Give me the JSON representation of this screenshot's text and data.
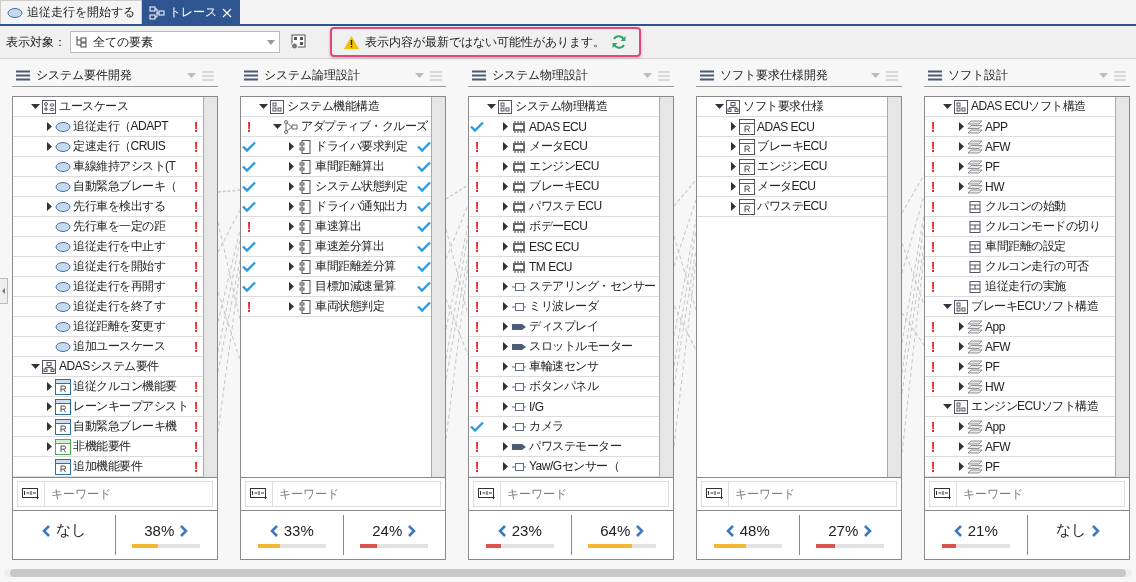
{
  "tabs": [
    {
      "label": "追従走行を開始する",
      "kind": "usecase",
      "selected": false,
      "closable": false
    },
    {
      "label": "トレース",
      "kind": "trace",
      "selected": true,
      "closable": true
    }
  ],
  "toolbar": {
    "label": "表示対象：",
    "target": "全ての要素",
    "warning": "表示内容が最新ではない可能性があります。"
  },
  "columns": [
    {
      "title": "システム要件開発",
      "search_placeholder": "キーワード",
      "tree": [
        {
          "label": "ユースケース",
          "kind": "usecase-diagram",
          "expanded": true,
          "children": [
            {
              "label": "追従走行（ADAPT",
              "kind": "usecase",
              "expanded": false,
              "mark_right": {
                "kind": "error",
                "text": "!"
              }
            },
            {
              "label": "定速走行（CRUIS",
              "kind": "usecase",
              "expanded": false,
              "mark_right": {
                "kind": "error",
                "text": "!"
              }
            },
            {
              "label": "車線維持アシスト(T",
              "kind": "usecase",
              "mark_right": {
                "kind": "error",
                "text": "!"
              }
            },
            {
              "label": "自動緊急ブレーキ（",
              "kind": "usecase",
              "mark_right": {
                "kind": "error",
                "text": "!"
              }
            },
            {
              "label": "先行車を検出する",
              "kind": "usecase",
              "expanded": false,
              "mark_right": {
                "kind": "error",
                "text": "!"
              }
            },
            {
              "label": "先行車を一定の距",
              "kind": "usecase",
              "mark_right": {
                "kind": "error",
                "text": "!"
              }
            },
            {
              "label": "追従走行を中止す",
              "kind": "usecase",
              "mark_right": {
                "kind": "error",
                "text": "!"
              }
            },
            {
              "label": "追従走行を開始す",
              "kind": "usecase",
              "mark_right": {
                "kind": "error",
                "text": "!"
              }
            },
            {
              "label": "追従走行を再開す",
              "kind": "usecase",
              "mark_right": {
                "kind": "error",
                "text": "!"
              }
            },
            {
              "label": "追従走行を終了す",
              "kind": "usecase",
              "mark_right": {
                "kind": "error",
                "text": "!"
              }
            },
            {
              "label": "追従距離を変更す",
              "kind": "usecase",
              "mark_right": {
                "kind": "error",
                "text": "!"
              }
            },
            {
              "label": "追加ユースケース",
              "kind": "usecase",
              "mark_right": {
                "kind": "error",
                "text": "!"
              }
            }
          ]
        },
        {
          "label": "ADASシステム要件",
          "kind": "package",
          "expanded": true,
          "children": [
            {
              "label": "追従クルコン機能要",
              "kind": "requirement",
              "expanded": false,
              "mark_right": {
                "kind": "error",
                "text": "!"
              }
            },
            {
              "label": "レーンキープアシスト",
              "kind": "requirement",
              "expanded": false,
              "mark_right": {
                "kind": "error",
                "text": "!"
              }
            },
            {
              "label": "自動緊急ブレーキ機",
              "kind": "requirement",
              "expanded": false,
              "mark_right": {
                "kind": "error",
                "text": "!"
              }
            },
            {
              "label": "非機能要件",
              "kind": "requirement-green",
              "expanded": false,
              "mark_right": {
                "kind": "error",
                "text": "!"
              }
            },
            {
              "label": "追加機能要件",
              "kind": "requirement",
              "mark_right": {
                "kind": "error",
                "text": "!"
              }
            }
          ]
        }
      ],
      "stats": [
        {
          "text": "なし"
        },
        {
          "text": "38%",
          "level": 0.38,
          "color": "#f5b731"
        }
      ]
    },
    {
      "title": "システム論理設計",
      "search_placeholder": "キーワード",
      "tree": [
        {
          "label": "システム機能構造",
          "kind": "structure",
          "expanded": true,
          "children": [
            {
              "label": "アダプティブ・クルーズ",
              "kind": "function",
              "expanded": true,
              "mark_left": {
                "kind": "error",
                "text": "!"
              },
              "children": [
                {
                  "label": "ドライバ要求判定",
                  "kind": "component",
                  "expanded": false,
                  "mark_left": {
                    "kind": "ok"
                  },
                  "mark_right": {
                    "kind": "ok"
                  }
                },
                {
                  "label": "車間距離算出",
                  "kind": "component",
                  "expanded": false,
                  "mark_left": {
                    "kind": "ok"
                  },
                  "mark_right": {
                    "kind": "ok"
                  }
                },
                {
                  "label": "システム状態判定",
                  "kind": "component",
                  "expanded": false,
                  "mark_left": {
                    "kind": "ok"
                  },
                  "mark_right": {
                    "kind": "ok"
                  }
                },
                {
                  "label": "ドライバ通知出力",
                  "kind": "component",
                  "expanded": false,
                  "mark_left": {
                    "kind": "ok"
                  },
                  "mark_right": {
                    "kind": "ok"
                  }
                },
                {
                  "label": "車速算出",
                  "kind": "component",
                  "expanded": false,
                  "mark_left": {
                    "kind": "error",
                    "text": "!"
                  },
                  "mark_right": {
                    "kind": "ok"
                  }
                },
                {
                  "label": "車速差分算出",
                  "kind": "component",
                  "expanded": false,
                  "mark_left": {
                    "kind": "ok"
                  },
                  "mark_right": {
                    "kind": "ok"
                  }
                },
                {
                  "label": "車間距離差分算",
                  "kind": "component",
                  "expanded": false,
                  "mark_left": {
                    "kind": "ok"
                  },
                  "mark_right": {
                    "kind": "ok"
                  }
                },
                {
                  "label": "目標加減速量算",
                  "kind": "component",
                  "expanded": false,
                  "mark_left": {
                    "kind": "ok"
                  },
                  "mark_right": {
                    "kind": "ok"
                  }
                },
                {
                  "label": "車両状態判定",
                  "kind": "component",
                  "expanded": false,
                  "mark_left": {
                    "kind": "error",
                    "text": "!"
                  },
                  "mark_right": {
                    "kind": "ok"
                  }
                }
              ]
            }
          ]
        }
      ],
      "stats": [
        {
          "text": "33%",
          "level": 0.33,
          "color": "#f5b731"
        },
        {
          "text": "24%",
          "level": 0.24,
          "color": "#d9534f"
        }
      ]
    },
    {
      "title": "システム物理設計",
      "search_placeholder": "キーワード",
      "tree": [
        {
          "label": "システム物理構造",
          "kind": "physical-structure",
          "expanded": true,
          "children": [
            {
              "label": "ADAS ECU",
              "kind": "ecu",
              "expanded": false,
              "mark_left": {
                "kind": "ok"
              }
            },
            {
              "label": "メータECU",
              "kind": "ecu",
              "expanded": false,
              "mark_left": {
                "kind": "error",
                "text": "!"
              }
            },
            {
              "label": "エンジンECU",
              "kind": "ecu",
              "expanded": false,
              "mark_left": {
                "kind": "error",
                "text": "!"
              }
            },
            {
              "label": "ブレーキECU",
              "kind": "ecu",
              "expanded": false,
              "mark_left": {
                "kind": "error",
                "text": "!"
              }
            },
            {
              "label": "パワステ ECU",
              "kind": "ecu",
              "expanded": false,
              "mark_left": {
                "kind": "error",
                "text": "!"
              }
            },
            {
              "label": "ボデーECU",
              "kind": "ecu",
              "expanded": false,
              "mark_left": {
                "kind": "error",
                "text": "!"
              }
            },
            {
              "label": "ESC ECU",
              "kind": "ecu",
              "expanded": false,
              "mark_left": {
                "kind": "error",
                "text": "!"
              }
            },
            {
              "label": "TM ECU",
              "kind": "ecu",
              "expanded": false,
              "mark_left": {
                "kind": "error",
                "text": "!"
              }
            },
            {
              "label": "ステアリング・センサー",
              "kind": "sensor",
              "expanded": false,
              "mark_left": {
                "kind": "error",
                "text": "!"
              }
            },
            {
              "label": "ミリ波レーダ",
              "kind": "sensor",
              "expanded": false,
              "mark_left": {
                "kind": "error",
                "text": "!"
              }
            },
            {
              "label": "ディスプレイ",
              "kind": "actuator",
              "expanded": false,
              "mark_left": {
                "kind": "error",
                "text": "!"
              }
            },
            {
              "label": "スロットルモーター",
              "kind": "actuator",
              "expanded": false,
              "mark_left": {
                "kind": "error",
                "text": "!"
              }
            },
            {
              "label": "車輪速センサ",
              "kind": "sensor",
              "expanded": false,
              "mark_left": {
                "kind": "error",
                "text": "!"
              }
            },
            {
              "label": "ボタンパネル",
              "kind": "sensor",
              "expanded": false,
              "mark_left": {
                "kind": "error",
                "text": "!"
              }
            },
            {
              "label": "I/G",
              "kind": "sensor",
              "expanded": false,
              "mark_left": {
                "kind": "error",
                "text": "!"
              }
            },
            {
              "label": "カメラ",
              "kind": "sensor",
              "expanded": false,
              "mark_left": {
                "kind": "ok"
              }
            },
            {
              "label": "パワステモーター",
              "kind": "actuator",
              "expanded": false,
              "mark_left": {
                "kind": "error",
                "text": "!"
              }
            },
            {
              "label": "Yaw/Gセンサー（",
              "kind": "sensor",
              "expanded": false,
              "mark_left": {
                "kind": "error",
                "text": "!"
              }
            }
          ]
        }
      ],
      "stats": [
        {
          "text": "23%",
          "level": 0.23,
          "color": "#d9534f"
        },
        {
          "text": "64%",
          "level": 0.64,
          "color": "#f5b731"
        }
      ]
    },
    {
      "title": "ソフト要求仕様開発",
      "search_placeholder": "キーワード",
      "tree": [
        {
          "label": "ソフト要求仕様",
          "kind": "package",
          "expanded": true,
          "children": [
            {
              "label": "ADAS ECU",
              "kind": "requirement-plain",
              "expanded": false
            },
            {
              "label": "ブレーキECU",
              "kind": "requirement-plain",
              "expanded": false
            },
            {
              "label": "エンジンECU",
              "kind": "requirement-plain",
              "expanded": false
            },
            {
              "label": "メータECU",
              "kind": "requirement-plain",
              "expanded": false
            },
            {
              "label": "パワステECU",
              "kind": "requirement-plain",
              "expanded": false
            }
          ]
        }
      ],
      "stats": [
        {
          "text": "48%",
          "level": 0.48,
          "color": "#f5b731"
        },
        {
          "text": "27%",
          "level": 0.27,
          "color": "#d9534f"
        }
      ]
    },
    {
      "title": "ソフト設計",
      "search_placeholder": "キーワード",
      "tree": [
        {
          "label": "ADAS ECUソフト構造",
          "kind": "structure",
          "expanded": true,
          "children": [
            {
              "label": "APP",
              "kind": "layer",
              "expanded": false,
              "mark_left": {
                "kind": "error",
                "text": "!"
              }
            },
            {
              "label": "AFW",
              "kind": "layer",
              "expanded": false,
              "mark_left": {
                "kind": "error",
                "text": "!"
              }
            },
            {
              "label": "PF",
              "kind": "layer",
              "expanded": false,
              "mark_left": {
                "kind": "error",
                "text": "!"
              }
            },
            {
              "label": "HW",
              "kind": "layer",
              "expanded": false,
              "mark_left": {
                "kind": "error",
                "text": "!"
              }
            },
            {
              "label": "クルコンの始動",
              "kind": "item",
              "mark_left": {
                "kind": "error",
                "text": "!"
              }
            },
            {
              "label": "クルコンモードの切り",
              "kind": "item",
              "mark_left": {
                "kind": "error",
                "text": "!"
              }
            },
            {
              "label": "車間距離の設定",
              "kind": "item",
              "mark_left": {
                "kind": "error",
                "text": "!"
              }
            },
            {
              "label": "クルコン走行の可否",
              "kind": "item",
              "mark_left": {
                "kind": "error",
                "text": "!"
              }
            },
            {
              "label": "追従走行の実施",
              "kind": "item",
              "mark_left": {
                "kind": "error",
                "text": "!"
              }
            }
          ]
        },
        {
          "label": "ブレーキECUソフト構造",
          "kind": "structure",
          "expanded": true,
          "children": [
            {
              "label": "App",
              "kind": "layer",
              "expanded": false,
              "mark_left": {
                "kind": "error",
                "text": "!"
              }
            },
            {
              "label": "AFW",
              "kind": "layer",
              "expanded": false,
              "mark_left": {
                "kind": "error",
                "text": "!"
              }
            },
            {
              "label": "PF",
              "kind": "layer",
              "expanded": false,
              "mark_left": {
                "kind": "error",
                "text": "!"
              }
            },
            {
              "label": "HW",
              "kind": "layer",
              "expanded": false,
              "mark_left": {
                "kind": "error",
                "text": "!"
              }
            }
          ]
        },
        {
          "label": "エンジンECUソフト構造",
          "kind": "structure",
          "expanded": true,
          "children": [
            {
              "label": "App",
              "kind": "layer",
              "expanded": false,
              "mark_left": {
                "kind": "error",
                "text": "!"
              }
            },
            {
              "label": "AFW",
              "kind": "layer",
              "expanded": false,
              "mark_left": {
                "kind": "error",
                "text": "!"
              }
            },
            {
              "label": "PF",
              "kind": "layer",
              "expanded": false,
              "mark_left": {
                "kind": "error",
                "text": "!"
              }
            }
          ]
        }
      ],
      "stats": [
        {
          "text": "21%",
          "level": 0.21,
          "color": "#d9534f"
        },
        {
          "text": "なし"
        }
      ]
    }
  ]
}
